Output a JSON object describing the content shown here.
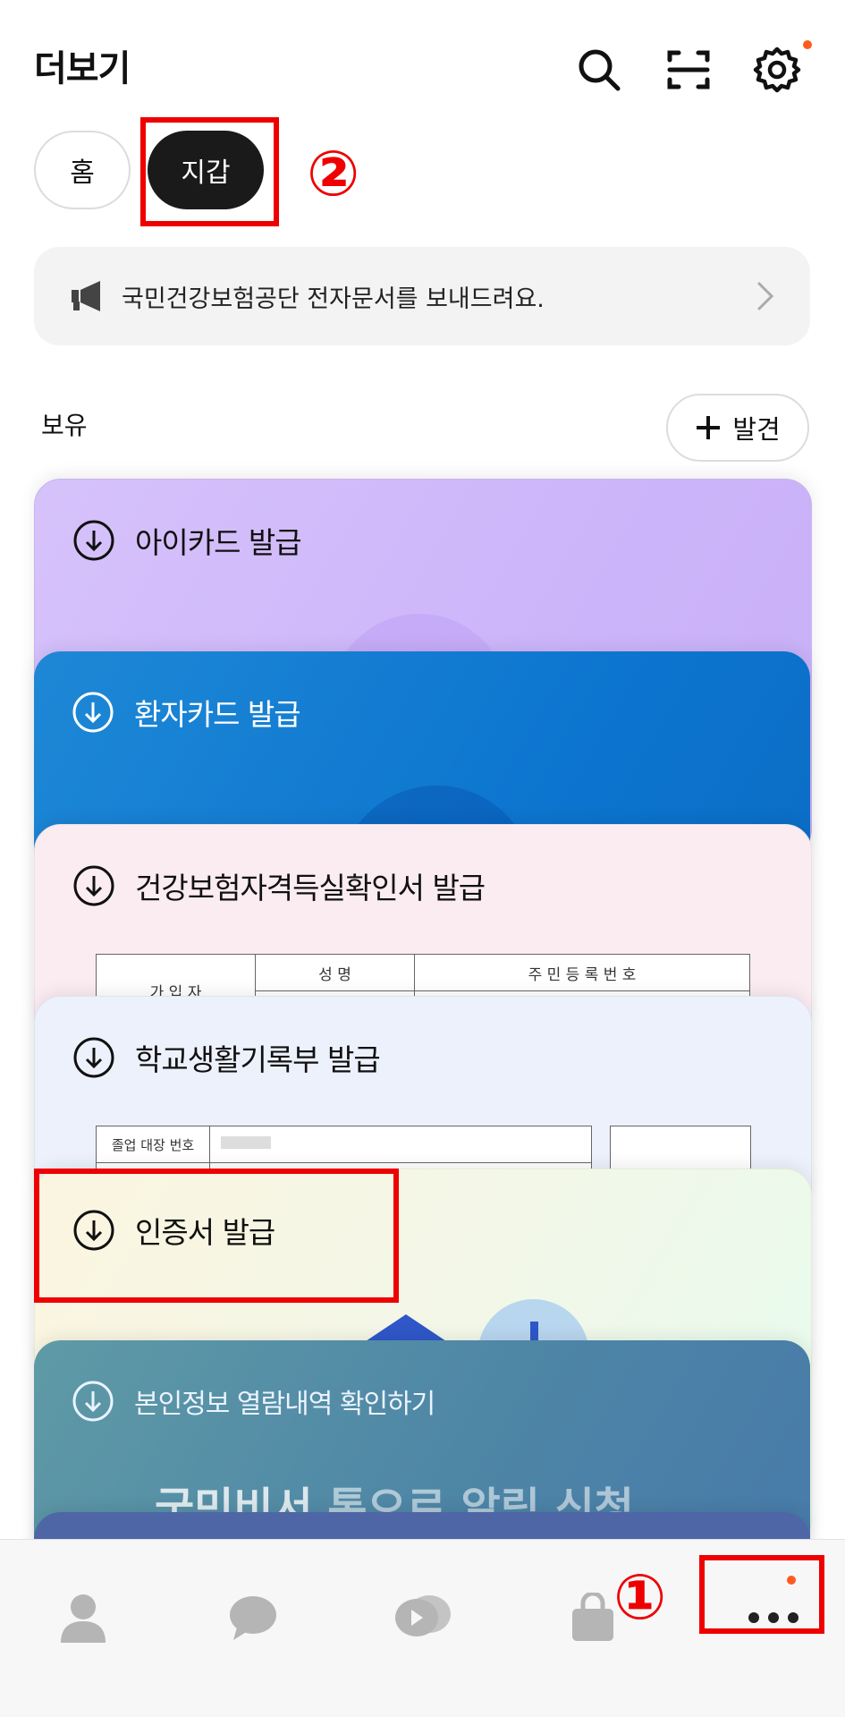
{
  "header": {
    "title": "더보기",
    "icons": [
      "search-icon",
      "scan-icon",
      "settings-icon"
    ],
    "notification_dot_color": "#ff5a1f"
  },
  "tabs": [
    {
      "label": "홈",
      "active": false
    },
    {
      "label": "지갑",
      "active": true
    }
  ],
  "annotations": {
    "step1": "①",
    "step2": "②",
    "color": "#ee0000"
  },
  "notice": {
    "text": "국민건강보험공단 전자문서를 보내드려요."
  },
  "section": {
    "title": "보유",
    "discover_label": "발견"
  },
  "cards": [
    {
      "label": "아이카드 발급",
      "bg": "#d3bcfa"
    },
    {
      "label": "환자카드 발급",
      "bg": "#0c75cf"
    },
    {
      "label": "건강보험자격득실확인서 발급",
      "bg": "#fbecf1"
    },
    {
      "label": "학교생활기록부 발급",
      "bg": "#edf1fb"
    },
    {
      "label": "인증서 발급",
      "bg": "#f3f7e8"
    },
    {
      "label": "본인정보 열람내역 확인하기",
      "bg": "#4e86a6"
    }
  ],
  "card3_doc": {
    "col1": "성  명",
    "col2": "주 민 등 록 번 호",
    "row_label": "가 입 자"
  },
  "card4_doc": {
    "cell1": "졸업 대장 번호"
  },
  "card6_promo": {
    "bold": "국민비서",
    "rest": " 톡으로 알림 신청"
  },
  "bottom_nav": [
    "profile-icon",
    "chat-icon",
    "openchat-icon",
    "shopping-icon",
    "more-icon"
  ]
}
